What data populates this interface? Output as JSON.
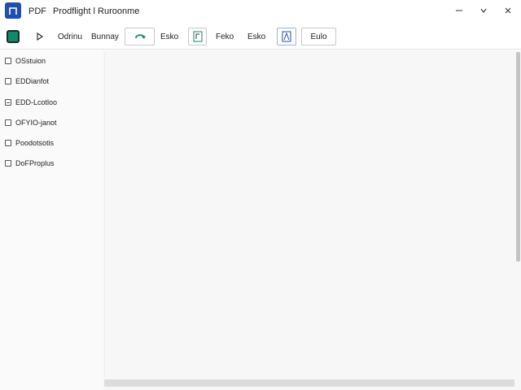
{
  "titlebar": {
    "app_name": "PDF",
    "doc_title": "Prodflight l Ruroonme",
    "icons": [
      "app-logo-icon",
      "minimize-icon",
      "chevron-down-icon",
      "close-icon"
    ]
  },
  "toolbar": {
    "label_1": "Odrinu",
    "label_2": "Bunnay",
    "label_3": "Esko",
    "label_4": "Feko",
    "label_5": "Esko",
    "button_last": "Eulo",
    "icons": [
      "square-icon",
      "play-icon",
      "rotate-icon",
      "page-icon",
      "font-icon"
    ],
    "colors": {
      "accent_green": "#0f8a6a",
      "accent_blue": "#1f4fb0"
    }
  },
  "sidebar": {
    "items": [
      {
        "label": "OSstuion"
      },
      {
        "label": "EDDianfot"
      },
      {
        "label": "EDD-Lcotloo"
      },
      {
        "label": "OFYIO-janot"
      },
      {
        "label": "Poodotsotis"
      },
      {
        "label": "DoFProplus"
      }
    ]
  }
}
